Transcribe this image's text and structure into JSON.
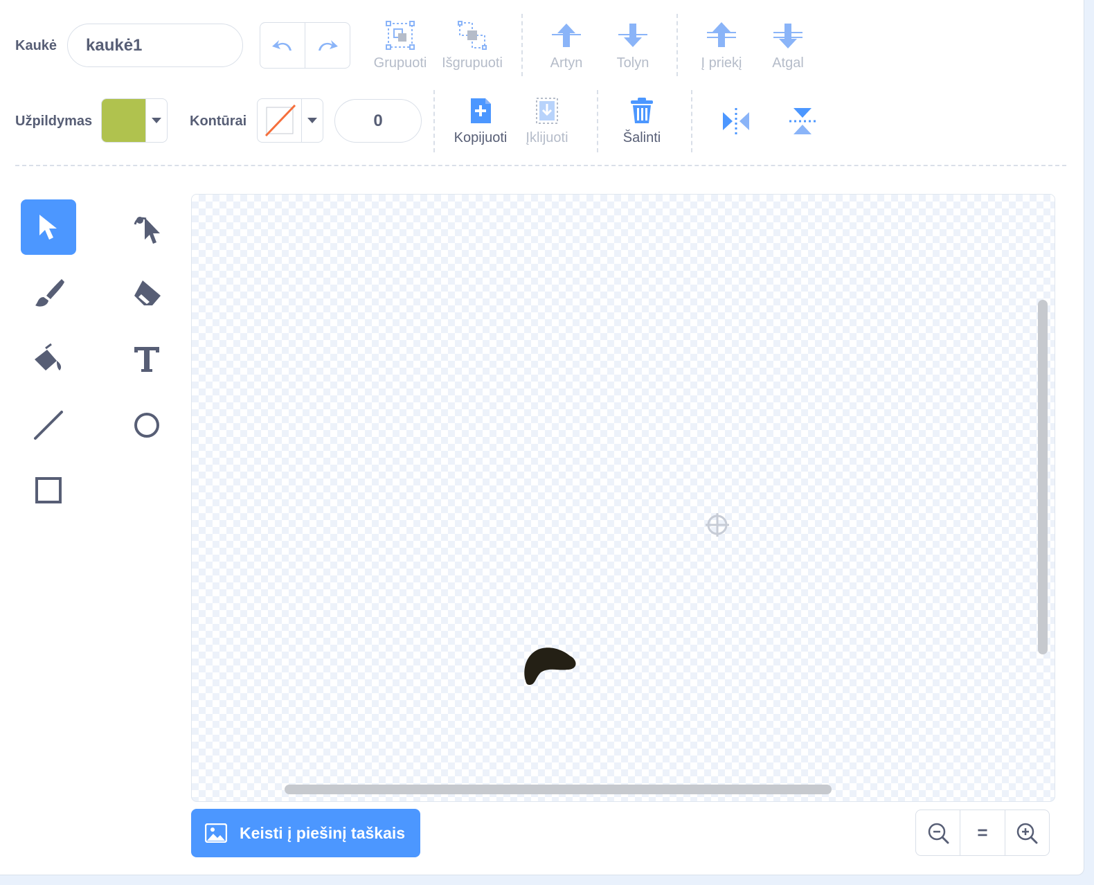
{
  "costume": {
    "label": "Kaukė",
    "name_value": "kaukė1"
  },
  "toolbar_top": {
    "group": "Grupuoti",
    "ungroup": "Išgrupuoti",
    "forward": "Artyn",
    "backward": "Tolyn",
    "front": "Į priekį",
    "back": "Atgal"
  },
  "toolbar_bottom": {
    "fill_label": "Užpildymas",
    "fill_color": "#b0c24e",
    "outline_label": "Kontūrai",
    "outline_width": "0",
    "copy": "Kopijuoti",
    "paste": "Įklijuoti",
    "delete": "Šalinti"
  },
  "tools": [
    "select",
    "reshape",
    "brush",
    "eraser",
    "fill",
    "text",
    "line",
    "circle",
    "rectangle"
  ],
  "selected_tool": "select",
  "convert_button": "Keisti į piešinį taškais",
  "zoom": {
    "out": "zoom-out",
    "reset": "=",
    "in": "zoom-in"
  },
  "colors": {
    "accent": "#4c97ff",
    "text": "#575e75",
    "muted": "#b5bcc9",
    "shape": "#242015"
  }
}
